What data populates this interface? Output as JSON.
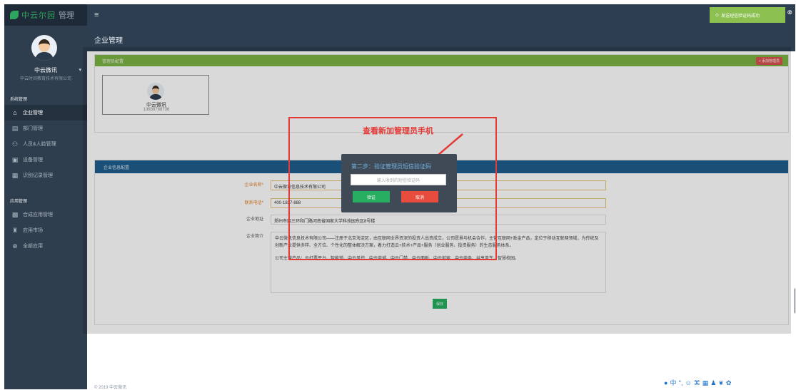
{
  "sidebar": {
    "logo_brand": "中云尔园",
    "logo_suffix": "管理",
    "profile": {
      "name": "中云微讯",
      "company": "中云时间教育技术有限公司"
    },
    "section_business": "系统管理",
    "items_business": [
      {
        "icon": "home-icon",
        "glyph": "⌂",
        "label": "企业管理"
      },
      {
        "icon": "department-icon",
        "glyph": "▤",
        "label": "部门管理"
      },
      {
        "icon": "user-icon",
        "glyph": "⚇",
        "label": "人员&人脸管理"
      },
      {
        "icon": "device-icon",
        "glyph": "▣",
        "label": "设备管理"
      },
      {
        "icon": "record-icon",
        "glyph": "▦",
        "label": "识别记录管理"
      }
    ],
    "section_apps": "应用管理",
    "items_apps": [
      {
        "icon": "apps-icon",
        "glyph": "▩",
        "label": "合成应用管理"
      },
      {
        "icon": "market-icon",
        "glyph": "♜",
        "label": "应用市场"
      },
      {
        "icon": "all-apps-icon",
        "glyph": "⊕",
        "label": "全部应用"
      }
    ]
  },
  "topbar": {
    "menu_icon": "≡",
    "toast": {
      "icon": "⊙",
      "text": "发送短信验证码成功",
      "close": "⊗"
    }
  },
  "page": {
    "title": "企业管理"
  },
  "admin_panel": {
    "header": "管理员配置",
    "add_button": "+ 添加管理员",
    "card": {
      "name": "中云微讯",
      "phone": "13838788736"
    }
  },
  "info_panel": {
    "header": "企业信息配置",
    "fields": {
      "company_name_label": "企业名称*",
      "company_name_value": "中云微讯信息技术有限公司",
      "contact_label": "联系电话*",
      "contact_value": "400-1837-888",
      "address_label": "企业地址",
      "address_value": "郑州市西三环和门路河南省国家大学科技园东区8号楼",
      "intro_label": "企业简介",
      "intro_p1": "中云微讯信息技术有限公司——注册于北京海淀区，由互联网业界资深的投资人出资成立，公司愿景与机会合作，主营互联网+政金产品，定位于移动互联网领域，为传统及创新产业提供多样、全方位、个性化的整体解决方案，着力打造云+技术+产品+服务（创业服务、投资服务）的生态服务体系。",
      "intro_p2": "公司主营产品：云打票平台、智能锁、中云风控、中云商城、中云门禁、中云面板、中云前家、中云商务、共享单车、智慧校园。"
    },
    "save_label": "保存"
  },
  "modal": {
    "title": "第二步：验证管理员短信验证码",
    "input_placeholder": "输入收到的短信验证码",
    "confirm_label": "验证",
    "cancel_label": "取消"
  },
  "annotation": {
    "text": "查看新加管理员手机"
  },
  "footer": {
    "copyright": "© 2019 中云微讯"
  },
  "ime_toolbar": [
    "●",
    "中",
    "°,",
    "☺",
    "⌘",
    "▦",
    "♟",
    "❦",
    "✿"
  ],
  "colors": {
    "sidebar_bg": "#2f3e4e",
    "topbar_bg": "#2c3e50",
    "green_header": "#7cb342",
    "blue_header": "#1f5e8c",
    "toast_bg": "#8cc152",
    "confirm": "#27ae60",
    "cancel": "#e74c3c",
    "annotation_red": "#e53935"
  }
}
